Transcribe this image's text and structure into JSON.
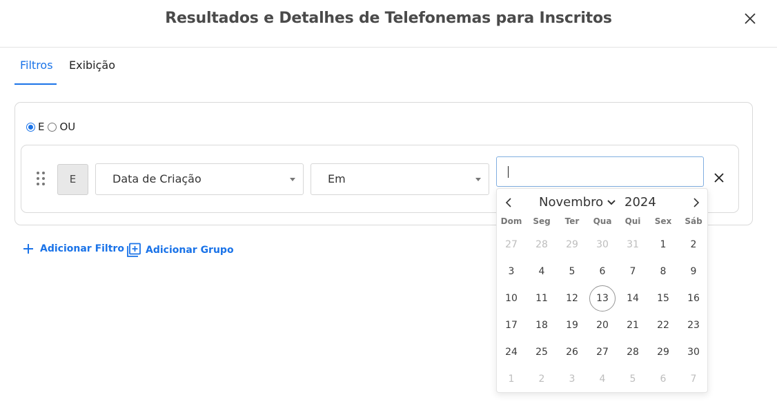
{
  "dialog": {
    "title": "Resultados e Detalhes de Telefonemas para Inscritos"
  },
  "tabs": [
    {
      "label": "Filtros",
      "active": true
    },
    {
      "label": "Exibição",
      "active": false
    }
  ],
  "logic": {
    "options": [
      {
        "label": "E",
        "checked": true
      },
      {
        "label": "OU",
        "checked": false
      }
    ]
  },
  "filter_row": {
    "group_operator": "E",
    "field": "Data de Criação",
    "operator": "Em",
    "value": ""
  },
  "actions": {
    "add_filter": "Adicionar Filtro",
    "add_group": "Adicionar Grupo"
  },
  "calendar": {
    "month": "Novembro",
    "year": "2024",
    "weekdays": [
      "Dom",
      "Seg",
      "Ter",
      "Qua",
      "Qui",
      "Sex",
      "Sáb"
    ],
    "weeks": [
      [
        {
          "d": "27",
          "m": true
        },
        {
          "d": "28",
          "m": true
        },
        {
          "d": "29",
          "m": true
        },
        {
          "d": "30",
          "m": true
        },
        {
          "d": "31",
          "m": true
        },
        {
          "d": "1"
        },
        {
          "d": "2"
        }
      ],
      [
        {
          "d": "3"
        },
        {
          "d": "4"
        },
        {
          "d": "5"
        },
        {
          "d": "6"
        },
        {
          "d": "7"
        },
        {
          "d": "8"
        },
        {
          "d": "9"
        }
      ],
      [
        {
          "d": "10"
        },
        {
          "d": "11"
        },
        {
          "d": "12"
        },
        {
          "d": "13",
          "today": true
        },
        {
          "d": "14"
        },
        {
          "d": "15"
        },
        {
          "d": "16"
        }
      ],
      [
        {
          "d": "17"
        },
        {
          "d": "18"
        },
        {
          "d": "19"
        },
        {
          "d": "20"
        },
        {
          "d": "21"
        },
        {
          "d": "22"
        },
        {
          "d": "23"
        }
      ],
      [
        {
          "d": "24"
        },
        {
          "d": "25"
        },
        {
          "d": "26"
        },
        {
          "d": "27"
        },
        {
          "d": "28"
        },
        {
          "d": "29"
        },
        {
          "d": "30"
        }
      ],
      [
        {
          "d": "1",
          "m": true
        },
        {
          "d": "2",
          "m": true
        },
        {
          "d": "3",
          "m": true
        },
        {
          "d": "4",
          "m": true
        },
        {
          "d": "5",
          "m": true
        },
        {
          "d": "6",
          "m": true
        },
        {
          "d": "7",
          "m": true
        }
      ]
    ]
  },
  "colors": {
    "accent": "#1a73e8",
    "border": "#d9d9d9",
    "muted_day": "#bdbdbd"
  }
}
